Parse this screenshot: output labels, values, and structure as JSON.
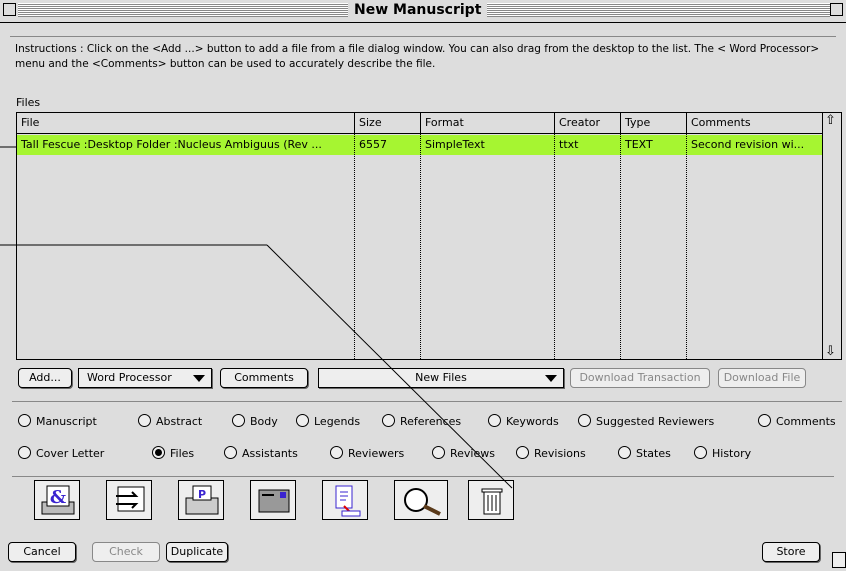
{
  "window": {
    "title": "New Manuscript"
  },
  "instructions": "Instructions : Click on the <Add ...> button to add a file from a file dialog window.  You can also drag from the desktop to the list.  The < Word Processor> menu and the <Comments> button can be used to accurately describe the file.",
  "files_label": "Files",
  "table": {
    "headers": [
      "File",
      "Size",
      "Format",
      "Creator",
      "Type",
      "Comments"
    ],
    "rows": [
      {
        "file": "Tall Fescue :Desktop Folder :Nucleus Ambiguus (Rev ...",
        "size": "6557",
        "format": "SimpleText",
        "creator": "ttxt",
        "type": "TEXT",
        "comments": "Second revision wi..."
      }
    ],
    "selected_row_color": "#a6f531"
  },
  "buttons": {
    "add": "Add...",
    "word_processor": "Word Processor",
    "comments": "Comments",
    "new_files": "New Files",
    "download_transaction": "Download Transaction",
    "download_file": "Download File",
    "cancel": "Cancel",
    "check": "Check",
    "duplicate": "Duplicate",
    "store": "Store"
  },
  "radios": [
    {
      "label": "Manuscript",
      "selected": false
    },
    {
      "label": "Abstract",
      "selected": false
    },
    {
      "label": "Body",
      "selected": false
    },
    {
      "label": "Legends",
      "selected": false
    },
    {
      "label": "References",
      "selected": false
    },
    {
      "label": "Keywords",
      "selected": false
    },
    {
      "label": "Suggested Reviewers",
      "selected": false
    },
    {
      "label": "Comments",
      "selected": false
    },
    {
      "label": "Cover Letter",
      "selected": false
    },
    {
      "label": "Files",
      "selected": true
    },
    {
      "label": "Assistants",
      "selected": false
    },
    {
      "label": "Reviewers",
      "selected": false
    },
    {
      "label": "Reviews",
      "selected": false
    },
    {
      "label": "Revisions",
      "selected": false
    },
    {
      "label": "States",
      "selected": false
    },
    {
      "label": "History",
      "selected": false
    }
  ],
  "toolbar_icons": [
    "print-ampersand-icon",
    "transfer-icon",
    "printer-icon",
    "mail-icon",
    "document-export-icon",
    "search-magnifier-icon",
    "trash-icon"
  ]
}
